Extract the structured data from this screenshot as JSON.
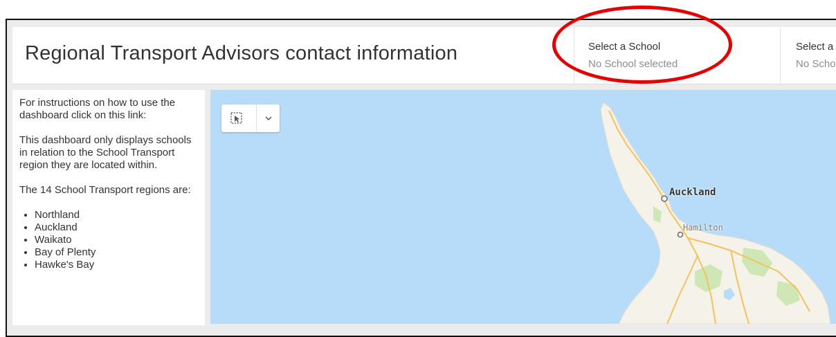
{
  "header": {
    "title": "Regional Transport Advisors contact information"
  },
  "selectors": [
    {
      "label": "Select a School",
      "value": "No School selected"
    },
    {
      "label": "Select a",
      "value": "No Scho"
    }
  ],
  "sidebar": {
    "intro": "For instructions on how to use the dashboard click on this link:",
    "note": "This dashboard only displays schools in relation to the School Transport region they are located within.",
    "regions_heading": "The 14 School Transport regions are:",
    "regions": [
      "Northland",
      "Auckland",
      "Waikato",
      "Bay of Plenty",
      "Hawke's Bay"
    ]
  },
  "map": {
    "cities": {
      "auckland": "Auckland",
      "hamilton": "Hamilton"
    },
    "icons": {
      "tool": "select-by-rectangle-icon",
      "dropdown": "chevron-down-icon"
    }
  },
  "colors": {
    "water": "#b6dcf9",
    "land": "#f5f2e9",
    "roads": "#f4c15a",
    "callout": "#e60000"
  }
}
